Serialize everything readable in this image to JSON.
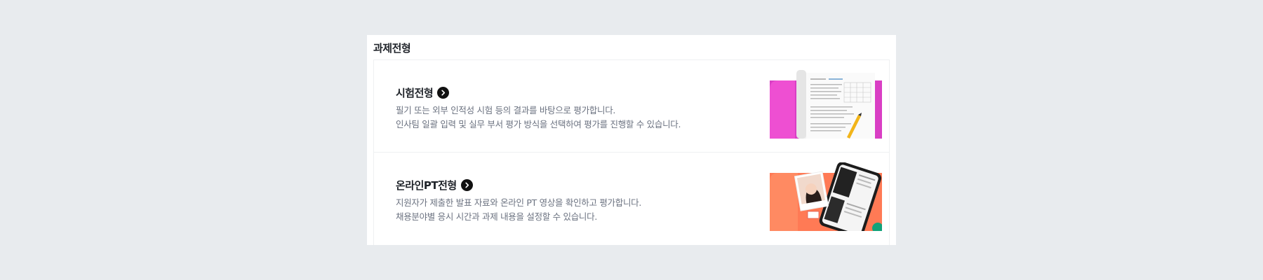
{
  "section": {
    "title": "과제전형"
  },
  "cards": [
    {
      "title": "시험전형",
      "lines": [
        "필기 또는 외부 인적성 시험 등의 결과를 바탕으로 평가합니다.",
        "인사팀 일괄 입력 및 실무 부서 평가 방식을 선택하여 평가를 진행할 수 있습니다."
      ],
      "accent": "#d93fc4"
    },
    {
      "title": "온라인PT전형",
      "lines": [
        "지원자가 제출한 발표 자료와 온라인 PT 영상을 확인하고 평가합니다.",
        "채용분야별 응시 시간과 과제 내용을 설정할 수 있습니다."
      ],
      "accent": "#ff7a55"
    }
  ]
}
